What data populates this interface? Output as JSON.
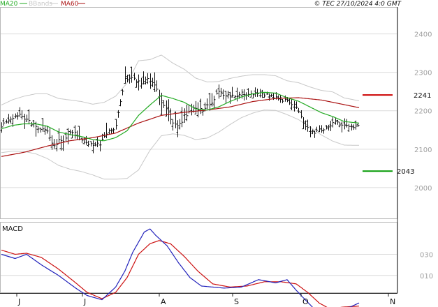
{
  "chart_data": {
    "type": "ohlc",
    "legend": {
      "ma20": {
        "label": "MA20",
        "color": "#22aa22"
      },
      "bbands": {
        "label": "BBands",
        "color": "#c8c8c8"
      },
      "ma60": {
        "label": "MA60",
        "color": "#aa1111"
      }
    },
    "copyright": "© TEC 27/10/2024 4:0 GMT",
    "price": {
      "ylim": [
        1920,
        2470
      ],
      "yticks": [
        2000,
        2100,
        2200,
        2300,
        2400
      ],
      "ytick_labels": [
        "2000",
        "2100",
        "2200",
        "2300",
        "2400"
      ],
      "resistance": {
        "value": 2241,
        "label": "2241",
        "color": "#cc0000"
      },
      "support": {
        "value": 2043,
        "label": "2043",
        "color": "#009900"
      },
      "anchors": {
        "close": [
          [
            0,
            2163
          ],
          [
            5,
            2170
          ],
          [
            10,
            2178
          ],
          [
            15,
            2190
          ],
          [
            20,
            2175
          ],
          [
            25,
            2170
          ],
          [
            30,
            2158
          ],
          [
            35,
            2150
          ],
          [
            40,
            2145
          ],
          [
            45,
            2105
          ],
          [
            50,
            2122
          ],
          [
            55,
            2118
          ],
          [
            60,
            2148
          ],
          [
            65,
            2140
          ],
          [
            70,
            2125
          ],
          [
            75,
            2115
          ],
          [
            80,
            2108
          ],
          [
            85,
            2112
          ],
          [
            90,
            2130
          ],
          [
            95,
            2148
          ],
          [
            100,
            2160
          ],
          [
            105,
            2240
          ],
          [
            108,
            2285
          ],
          [
            112,
            2285
          ],
          [
            117,
            2280
          ],
          [
            122,
            2270
          ],
          [
            128,
            2285
          ],
          [
            133,
            2275
          ],
          [
            140,
            2220
          ],
          [
            145,
            2200
          ],
          [
            150,
            2170
          ],
          [
            155,
            2160
          ],
          [
            160,
            2185
          ],
          [
            165,
            2200
          ],
          [
            170,
            2210
          ],
          [
            175,
            2200
          ],
          [
            180,
            2215
          ],
          [
            185,
            2220
          ],
          [
            190,
            2255
          ],
          [
            195,
            2242
          ],
          [
            200,
            2238
          ],
          [
            205,
            2240
          ],
          [
            210,
            2245
          ],
          [
            215,
            2240
          ],
          [
            220,
            2240
          ],
          [
            225,
            2245
          ],
          [
            230,
            2240
          ],
          [
            235,
            2238
          ],
          [
            240,
            2232
          ],
          [
            245,
            2230
          ],
          [
            250,
            2225
          ],
          [
            255,
            2220
          ],
          [
            260,
            2200
          ],
          [
            265,
            2160
          ],
          [
            270,
            2150
          ],
          [
            275,
            2145
          ],
          [
            280,
            2150
          ],
          [
            285,
            2155
          ],
          [
            290,
            2170
          ],
          [
            295,
            2165
          ],
          [
            300,
            2160
          ],
          [
            305,
            2155
          ],
          [
            310,
            2160
          ],
          [
            313,
            2165
          ]
        ],
        "range": [
          [
            0,
            24
          ],
          [
            20,
            36
          ],
          [
            40,
            32
          ],
          [
            60,
            36
          ],
          [
            80,
            30
          ],
          [
            100,
            40
          ],
          [
            120,
            40
          ],
          [
            140,
            50
          ],
          [
            160,
            50
          ],
          [
            180,
            40
          ],
          [
            200,
            34
          ],
          [
            220,
            26
          ],
          [
            240,
            20
          ],
          [
            260,
            34
          ],
          [
            280,
            24
          ],
          [
            300,
            24
          ],
          [
            313,
            20
          ]
        ],
        "ma20": [
          [
            0,
            2153
          ],
          [
            10,
            2162
          ],
          [
            20,
            2166
          ],
          [
            30,
            2166
          ],
          [
            40,
            2160
          ],
          [
            50,
            2145
          ],
          [
            60,
            2138
          ],
          [
            70,
            2133
          ],
          [
            80,
            2125
          ],
          [
            90,
            2122
          ],
          [
            100,
            2130
          ],
          [
            110,
            2148
          ],
          [
            120,
            2188
          ],
          [
            130,
            2215
          ],
          [
            140,
            2240
          ],
          [
            150,
            2232
          ],
          [
            160,
            2222
          ],
          [
            170,
            2205
          ],
          [
            180,
            2202
          ],
          [
            190,
            2210
          ],
          [
            200,
            2224
          ],
          [
            210,
            2236
          ],
          [
            220,
            2244
          ],
          [
            230,
            2248
          ],
          [
            240,
            2246
          ],
          [
            250,
            2234
          ],
          [
            260,
            2225
          ],
          [
            270,
            2210
          ],
          [
            280,
            2195
          ],
          [
            290,
            2185
          ],
          [
            300,
            2172
          ],
          [
            313,
            2168
          ]
        ],
        "ma60": [
          [
            0,
            2081
          ],
          [
            20,
            2092
          ],
          [
            40,
            2108
          ],
          [
            60,
            2122
          ],
          [
            80,
            2130
          ],
          [
            100,
            2142
          ],
          [
            120,
            2168
          ],
          [
            140,
            2188
          ],
          [
            160,
            2196
          ],
          [
            180,
            2202
          ],
          [
            200,
            2210
          ],
          [
            220,
            2224
          ],
          [
            240,
            2232
          ],
          [
            260,
            2234
          ],
          [
            280,
            2228
          ],
          [
            300,
            2216
          ],
          [
            313,
            2208
          ]
        ],
        "bb_width": [
          [
            0,
            62
          ],
          [
            20,
            72
          ],
          [
            40,
            84
          ],
          [
            60,
            90
          ],
          [
            80,
            92
          ],
          [
            100,
            108
          ],
          [
            110,
            124
          ],
          [
            120,
            142
          ],
          [
            130,
            118
          ],
          [
            150,
            92
          ],
          [
            170,
            80
          ],
          [
            190,
            66
          ],
          [
            210,
            54
          ],
          [
            230,
            46
          ],
          [
            250,
            44
          ],
          [
            270,
            52
          ],
          [
            290,
            64
          ],
          [
            313,
            58
          ]
        ]
      }
    },
    "macd": {
      "title": "MACD",
      "ylim": [
        -6,
        60
      ],
      "yticks": [
        10,
        30
      ],
      "ytick_labels": [
        "010",
        "030"
      ],
      "macd_line": {
        "color": "#2222bb",
        "values": [
          [
            0,
            30
          ],
          [
            12,
            26
          ],
          [
            22,
            30
          ],
          [
            35,
            20
          ],
          [
            50,
            10
          ],
          [
            65,
            -2
          ],
          [
            75,
            -9
          ],
          [
            88,
            -13
          ],
          [
            100,
            -1
          ],
          [
            108,
            14
          ],
          [
            115,
            32
          ],
          [
            125,
            51
          ],
          [
            130,
            54
          ],
          [
            135,
            48
          ],
          [
            145,
            38
          ],
          [
            155,
            22
          ],
          [
            165,
            8
          ],
          [
            175,
            0
          ],
          [
            195,
            -2
          ],
          [
            210,
            -1
          ],
          [
            225,
            6
          ],
          [
            240,
            3
          ],
          [
            250,
            6
          ],
          [
            258,
            -4
          ],
          [
            265,
            -12
          ],
          [
            275,
            -23
          ],
          [
            285,
            -25
          ],
          [
            295,
            -21
          ],
          [
            305,
            -20
          ],
          [
            313,
            -16
          ]
        ]
      },
      "signal_line": {
        "color": "#cc1111",
        "values": [
          [
            0,
            34
          ],
          [
            12,
            30
          ],
          [
            22,
            31
          ],
          [
            35,
            27
          ],
          [
            50,
            16
          ],
          [
            65,
            3
          ],
          [
            75,
            -6
          ],
          [
            88,
            -12
          ],
          [
            100,
            -6
          ],
          [
            110,
            8
          ],
          [
            120,
            30
          ],
          [
            130,
            40
          ],
          [
            138,
            43
          ],
          [
            148,
            40
          ],
          [
            160,
            28
          ],
          [
            172,
            14
          ],
          [
            185,
            2
          ],
          [
            200,
            -1
          ],
          [
            215,
            0
          ],
          [
            230,
            4
          ],
          [
            245,
            4
          ],
          [
            258,
            2
          ],
          [
            268,
            -6
          ],
          [
            278,
            -16
          ],
          [
            288,
            -22
          ],
          [
            298,
            -20
          ],
          [
            313,
            -19
          ]
        ]
      }
    },
    "xaxis": {
      "tick_labels": [
        "J",
        "J",
        "A",
        "S",
        "O",
        "N"
      ]
    }
  }
}
